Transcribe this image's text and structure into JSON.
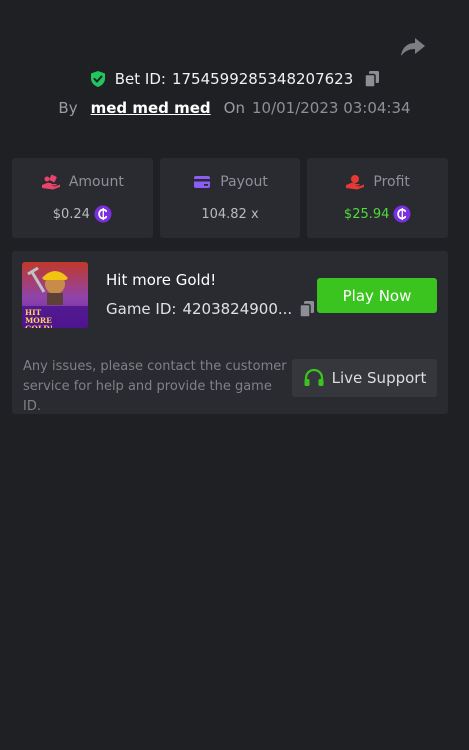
{
  "header": {
    "bet_label": "Bet ID:",
    "bet_id": "1754599285348207623",
    "by_label": "By",
    "username": "med med med",
    "on_label": "On",
    "datetime": "10/01/2023 03:04:34"
  },
  "stats": {
    "amount": {
      "label": "Amount",
      "value": "$0.24"
    },
    "payout": {
      "label": "Payout",
      "value": "104.82 x"
    },
    "profit": {
      "label": "Profit",
      "value": "$25.94"
    }
  },
  "game": {
    "title": "Hit more Gold!",
    "id_label": "Game ID:",
    "id_value": "4203824900...",
    "thumb_text": "HIT MORE GOLD!",
    "play_label": "Play Now"
  },
  "support": {
    "notice": "Any issues, please contact the customer service for help and provide the game ID.",
    "button_label": "Live Support"
  },
  "icons": {
    "share": "share-arrow-icon",
    "verified": "shield-check-icon",
    "copy": "copy-icon",
    "amount": "hand-coins-icon",
    "payout": "wallet-card-icon",
    "profit": "hand-money-icon",
    "coin": "coin-icon",
    "support": "headset-icon"
  },
  "colors": {
    "background": "#1f2024",
    "card": "#2a2b30",
    "accent_green": "#3bc41f",
    "profit_green": "#4fdb3b",
    "coin_purple": "#7a2fe0",
    "amount_icon": "#e8436b",
    "payout_icon": "#8b5cf6",
    "profit_icon": "#e53935"
  }
}
